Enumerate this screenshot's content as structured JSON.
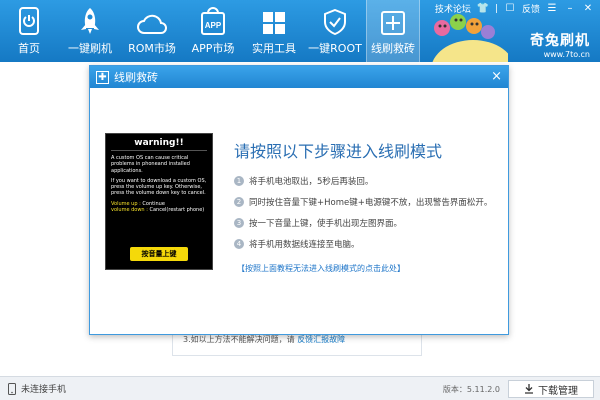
{
  "nav": [
    {
      "label": "首页",
      "icon": "home-icon"
    },
    {
      "label": "一键刷机",
      "icon": "rocket-icon"
    },
    {
      "label": "ROM市场",
      "icon": "cloud-icon"
    },
    {
      "label": "APP市场",
      "icon": "app-bag-icon"
    },
    {
      "label": "实用工具",
      "icon": "grid-icon"
    },
    {
      "label": "一键ROOT",
      "icon": "shield-icon"
    },
    {
      "label": "线刷救砖",
      "icon": "rescue-icon"
    }
  ],
  "topright": {
    "forum": "技术论坛",
    "feedback": "反馈"
  },
  "brand": {
    "name": "奇兔刷机",
    "url": "www.7to.cn"
  },
  "dialog": {
    "title": "线刷救砖",
    "heading": "请按照以下步骤进入线刷模式",
    "steps": [
      {
        "num": "1",
        "text": "将手机电池取出，5秒后再装回。"
      },
      {
        "num": "2",
        "text": "同时按住音量下键+Home键+电源键不放，出现警告界面松开。"
      },
      {
        "num": "3",
        "text": "按一下音量上键，使手机出现左图界面。"
      },
      {
        "num": "4",
        "text": "将手机用数据线连接至电脑。"
      }
    ],
    "help_link": "【按照上面教程无法进入线刷模式的点击此处】",
    "phone": {
      "warning": "warning!!",
      "p1": "A custom OS can cause critical problems in phoneand installed applications.",
      "p2": "If you want to download a custom OS, press the volume up key. Otherwise, press the volume down key to cancel.",
      "vol_up_label": "Volume up :",
      "vol_up_text": "Continue",
      "vol_down_label": "volume down :",
      "vol_down_text": "Cancel(restart phone)",
      "button": "按音量上键"
    }
  },
  "bg_card": {
    "text": "3.如以上方法不能解决问题，请",
    "link": "反馈汇报故障"
  },
  "status": {
    "device": "未连接手机",
    "version": "版本：5.11.2.0",
    "download": "下载管理"
  }
}
